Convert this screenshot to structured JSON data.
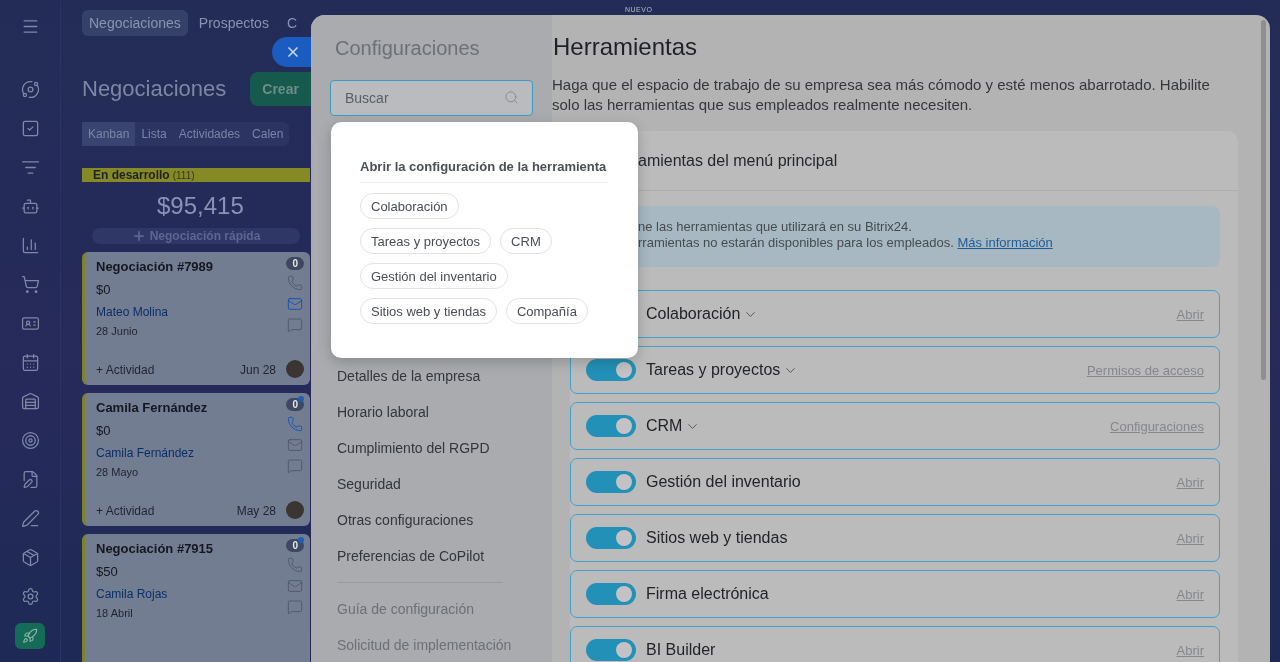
{
  "new_label": "NUEVO",
  "crm": {
    "top_tabs": [
      {
        "label": "Negociaciones",
        "selected": true
      },
      {
        "label": "Prospectos",
        "selected": false
      },
      {
        "label": "C",
        "selected": false
      }
    ],
    "title": "Negociaciones",
    "create_button": "Crear",
    "view_tabs": [
      {
        "label": "Kanban",
        "selected": true
      },
      {
        "label": "Lista",
        "selected": false
      },
      {
        "label": "Actividades",
        "selected": false
      },
      {
        "label": "Calen",
        "selected": false
      }
    ],
    "column": {
      "name": "En desarrollo",
      "count": "(111)",
      "total": "$95,415",
      "quick_add": "Negociación rápida"
    },
    "cards": [
      {
        "title": "Negociación #7989",
        "amount": "$0",
        "contact": "Mateo Molina",
        "date": "28 Junio",
        "activity": "+ Actividad",
        "due": "Jun 28",
        "badge": "0",
        "unread": false,
        "phone_active": false,
        "mail_active": true
      },
      {
        "title": "Camila Fernández",
        "amount": "$0",
        "contact": "Camila Fernández",
        "date": "28 Mayo",
        "activity": "+ Actividad",
        "due": "May 28",
        "badge": "0",
        "unread": true,
        "phone_active": true,
        "mail_active": false
      },
      {
        "title": "Negociación #7915",
        "amount": "$50",
        "contact": "Camila Rojas",
        "date": "18 Abril",
        "badge": "0",
        "unread": true,
        "phone_active": false,
        "mail_active": false
      }
    ]
  },
  "settings": {
    "title": "Configuraciones",
    "search": {
      "placeholder": "Buscar"
    },
    "nav": [
      {
        "label": "Detalles de la empresa",
        "muted": false
      },
      {
        "label": "Horario laboral",
        "muted": false
      },
      {
        "label": "Cumplimiento del RGPD",
        "muted": false
      },
      {
        "label": "Seguridad",
        "muted": false
      },
      {
        "label": "Otras configuraciones",
        "muted": false
      },
      {
        "label": "Preferencias de CoPilot",
        "muted": false
      },
      {
        "label": "Guía de configuración",
        "muted": true
      },
      {
        "label": "Solicitud de implementación",
        "muted": true
      }
    ],
    "popup": {
      "heading": "Abrir la configuración de la herramienta",
      "chips": [
        [
          "Colaboración"
        ],
        [
          "Tareas y proyectos",
          "CRM"
        ],
        [
          "Gestión del inventario"
        ],
        [
          "Sitios web y tiendas",
          "Compañía"
        ]
      ]
    }
  },
  "content": {
    "title": "Herramientas",
    "description": "Haga que el espacio de trabajo de su empresa sea más cómodo y esté menos abarrotado. Habilite solo las herramientas que sus empleados realmente necesiten.",
    "section": {
      "title": "amientas del menú principal",
      "info_lines": [
        "ne las herramientas que utilizará en su Bitrix24.",
        "rramientas no estarán disponibles para los empleados."
      ],
      "info_link": "Más información",
      "tools": [
        {
          "name": "Colaboración",
          "expandable": true,
          "action": "Abrir"
        },
        {
          "name": "Tareas y proyectos",
          "expandable": true,
          "on": true,
          "action": "Permisos de acceso"
        },
        {
          "name": "CRM",
          "expandable": true,
          "on": true,
          "action": "Configuraciones"
        },
        {
          "name": "Gestión del inventario",
          "expandable": false,
          "on": true,
          "action": "Abrir"
        },
        {
          "name": "Sitios web y tiendas",
          "expandable": false,
          "on": true,
          "action": "Abrir"
        },
        {
          "name": "Firma electrónica",
          "expandable": false,
          "on": true,
          "action": "Abrir"
        },
        {
          "name": "BI Builder",
          "expandable": false,
          "on": true,
          "action": "Abrir"
        }
      ]
    }
  }
}
